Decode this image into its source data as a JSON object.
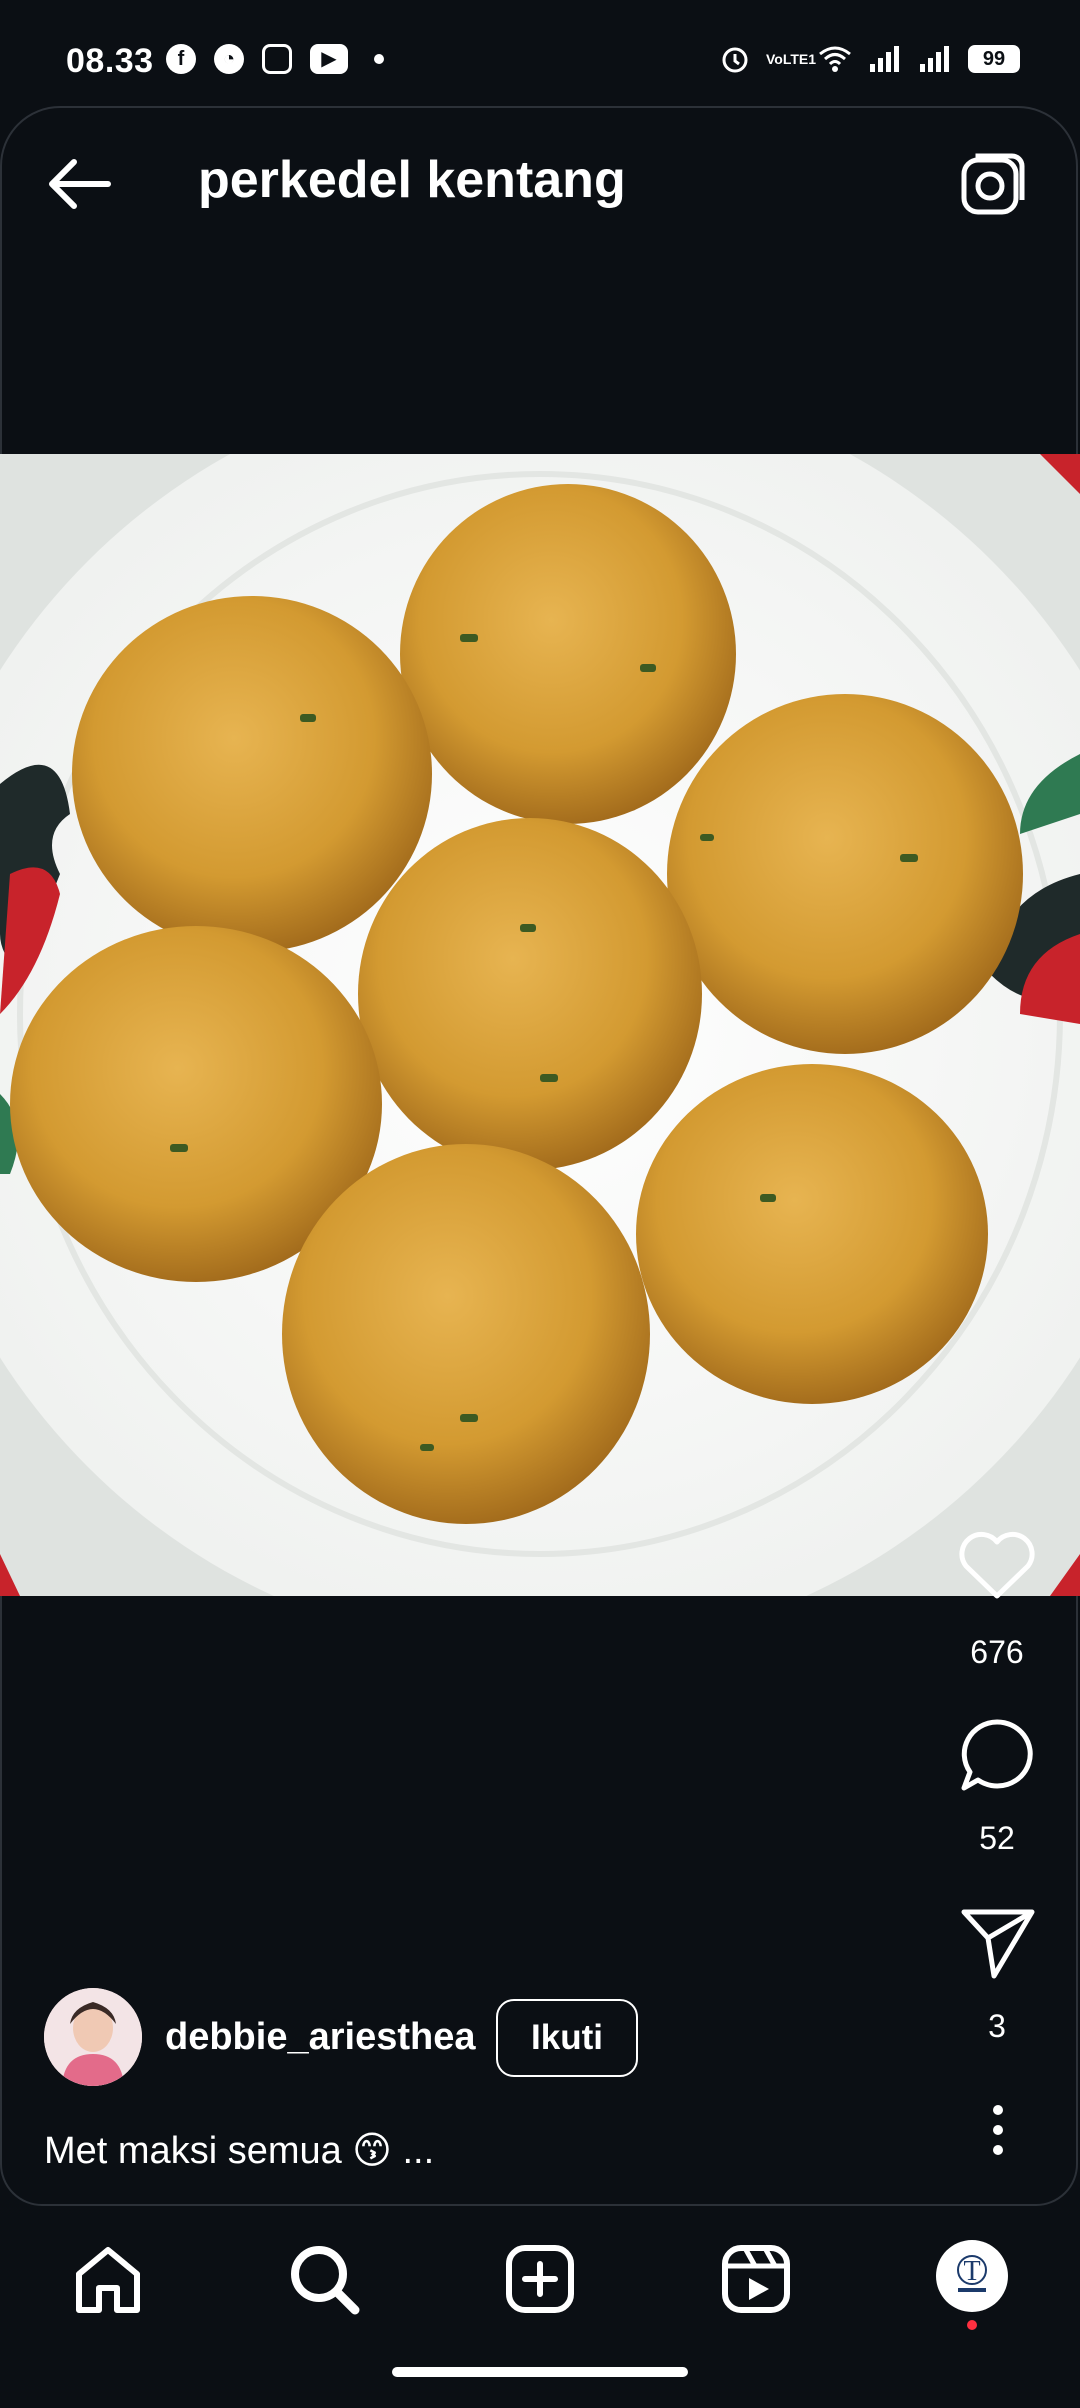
{
  "status_bar": {
    "time": "08.33",
    "left_icons": [
      "facebook-icon",
      "speedometer-icon",
      "instagram-icon",
      "youtube-icon",
      "notification-dot"
    ],
    "right_icons": [
      "alarm-icon",
      "volte-icon",
      "wifi-icon",
      "signal-icon",
      "signal-icon"
    ],
    "battery": "99",
    "volte_label": "VoLTE1"
  },
  "header": {
    "title": "perkedel kentang",
    "back_icon": "arrow-left-icon",
    "camera_icon": "camera-icon"
  },
  "post": {
    "image_alt": "fried potato patties on a plate",
    "colors": {
      "plate": "#f1f2f0",
      "patty": "#d89c2f",
      "rooster_red": "#c8232b",
      "rooster_green": "#2f7a52"
    }
  },
  "actions": {
    "likes": "676",
    "comments": "52",
    "shares": "3"
  },
  "author": {
    "username": "debbie_ariesthea",
    "follow_label": "Ikuti"
  },
  "caption": {
    "text": "Met maksi semua 😙 ..."
  },
  "bottom_nav": {
    "items": [
      "home-icon",
      "search-icon",
      "create-icon",
      "reels-icon",
      "profile-icon"
    ],
    "profile_badge_color": "#ff3040"
  }
}
